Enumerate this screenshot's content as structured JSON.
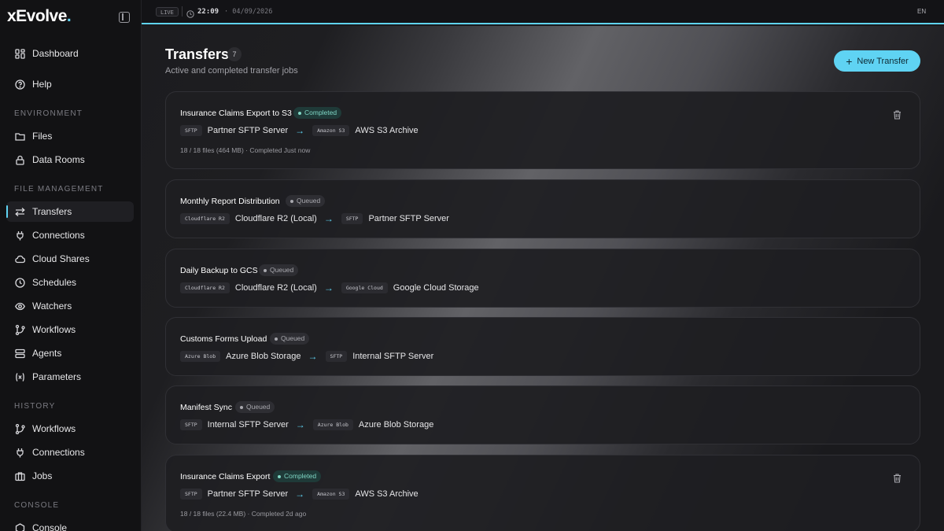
{
  "app": {
    "brand": "xEvolve",
    "brand_dot": "."
  },
  "topbar": {
    "live": "LIVE",
    "time": "22:09",
    "date": "· 04/09/2026",
    "lang": "EN"
  },
  "sidebar": {
    "top": [
      {
        "label": "Dashboard",
        "icon": "grid-icon"
      },
      {
        "label": "Help",
        "icon": "help-icon"
      }
    ],
    "sections": {
      "environment": "ENVIRONMENT",
      "file_management": "FILE MANAGEMENT",
      "history": "HISTORY",
      "console": "CONSOLE"
    },
    "environment": [
      {
        "label": "Files",
        "icon": "folder-icon"
      },
      {
        "label": "Data Rooms",
        "icon": "lock-icon"
      }
    ],
    "file_management": [
      {
        "label": "Transfers",
        "icon": "transfer-icon"
      },
      {
        "label": "Connections",
        "icon": "plug-icon"
      },
      {
        "label": "Cloud Shares",
        "icon": "cloud-icon"
      },
      {
        "label": "Schedules",
        "icon": "clock-icon"
      },
      {
        "label": "Watchers",
        "icon": "eye-icon"
      },
      {
        "label": "Workflows",
        "icon": "workflow-icon"
      },
      {
        "label": "Agents",
        "icon": "server-icon"
      },
      {
        "label": "Parameters",
        "icon": "variable-icon"
      }
    ],
    "history": [
      {
        "label": "Workflows",
        "icon": "workflow-icon"
      },
      {
        "label": "Connections",
        "icon": "plug-icon"
      },
      {
        "label": "Jobs",
        "icon": "briefcase-icon"
      }
    ],
    "console": [
      {
        "label": "Console",
        "icon": "hexagon-icon"
      }
    ]
  },
  "page": {
    "title": "Transfers",
    "count": "7",
    "subtitle": "Active and completed transfer jobs",
    "new_button": "New Transfer"
  },
  "transfers": [
    {
      "title": "Insurance Claims Export to S3",
      "status": "Completed",
      "src_tag": "SFTP",
      "src": "Partner SFTP Server",
      "dst_tag": "Amazon S3",
      "dst": "AWS S3 Archive",
      "meta": "18 / 18 files (464 MB) · Completed Just now"
    },
    {
      "title": "Monthly Report Distribution",
      "status": "Queued",
      "src_tag": "Cloudflare R2",
      "src": "Cloudflare R2 (Local)",
      "dst_tag": "SFTP",
      "dst": "Partner SFTP Server"
    },
    {
      "title": "Daily Backup to GCS",
      "status": "Queued",
      "src_tag": "Cloudflare R2",
      "src": "Cloudflare R2 (Local)",
      "dst_tag": "Google Cloud",
      "dst": "Google Cloud Storage"
    },
    {
      "title": "Customs Forms Upload",
      "status": "Queued",
      "src_tag": "Azure Blob",
      "src": "Azure Blob Storage",
      "dst_tag": "SFTP",
      "dst": "Internal SFTP Server"
    },
    {
      "title": "Manifest Sync",
      "status": "Queued",
      "src_tag": "SFTP",
      "src": "Internal SFTP Server",
      "dst_tag": "Azure Blob",
      "dst": "Azure Blob Storage"
    },
    {
      "title": "Insurance Claims Export",
      "status": "Completed",
      "src_tag": "SFTP",
      "src": "Partner SFTP Server",
      "dst_tag": "Amazon S3",
      "dst": "AWS S3 Archive",
      "meta": "18 / 18 files (22.4 MB) · Completed 2d ago"
    }
  ],
  "colors": {
    "accent": "#5fd3f3",
    "completed": "#7fd6c4",
    "queued": "#a8a8ae"
  }
}
